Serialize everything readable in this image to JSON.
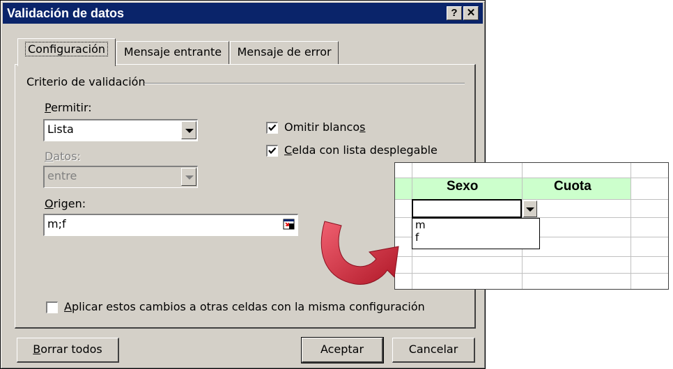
{
  "dialog": {
    "title": "Validación de datos",
    "help_btn": "?",
    "close_btn": "✕",
    "tabs": [
      "Configuración",
      "Mensaje entrante",
      "Mensaje de error"
    ],
    "group_label": "Criterio de validación",
    "permitir": {
      "label_u": "P",
      "label_rest": "ermitir:",
      "value": "Lista"
    },
    "datos": {
      "label_u": "D",
      "label_rest": "atos:",
      "value": "entre"
    },
    "origen": {
      "label_u": "O",
      "label_rest": "rigen:",
      "value": "m;f"
    },
    "omitir": {
      "text": "Omitir blanco",
      "u": "s",
      "checked": true
    },
    "celda": {
      "u": "C",
      "text": "elda con lista desplegable",
      "checked": true
    },
    "aplicar": {
      "u": "A",
      "text": "plicar estos cambios a otras celdas con la misma configuración",
      "checked": false
    },
    "buttons": {
      "borrar_u": "B",
      "borrar_rest": "orrar todos",
      "aceptar": "Aceptar",
      "cancelar": "Cancelar"
    }
  },
  "sheet": {
    "headers": [
      "Sexo",
      "Cuota"
    ],
    "list_items": [
      "m",
      "f"
    ]
  },
  "colors": {
    "titlebar": "#0a246a",
    "dialog_bg": "#d4d0c8",
    "header_band": "#ccffcc",
    "arrow": "#d42a3c"
  }
}
